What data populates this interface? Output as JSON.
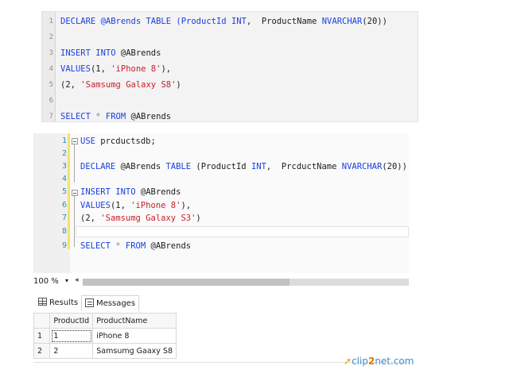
{
  "snippet": {
    "lines": [
      "1",
      "2",
      "3",
      "4",
      "5",
      "6",
      "7"
    ],
    "code": {
      "l1_a": "DECLARE @ABrends TABLE (ProductId ",
      "l1_int": "INT",
      "l1_b": ",  ProductName ",
      "l1_nv": "NVARCHAR",
      "l1_c": "(20))",
      "l3_a": "INSERT INTO",
      "l3_b": " @ABrends",
      "l4_a": "VALUES",
      "l4_b": "(1, ",
      "l4_str": "'iPhone 8'",
      "l4_c": "),",
      "l5_a": "(2, ",
      "l5_str": "'Samsumg Galaxy S8'",
      "l5_b": ")",
      "l7_a": "SELECT",
      "l7_b": " * ",
      "l7_c": "FROM",
      "l7_d": " @ABrends"
    }
  },
  "editor": {
    "lines": [
      "1",
      "2",
      "3",
      "4",
      "5",
      "6",
      "7",
      "8",
      "9"
    ],
    "code": {
      "l1_a": "USE",
      "l1_b": " prcductsdb;",
      "l3_a": "DECLARE",
      "l3_b": " @ABrends ",
      "l3_c": "TABLE",
      "l3_d": " (ProductId ",
      "l3_int": "INT",
      "l3_e": ",  PrcductName ",
      "l3_nv": "NVARCHAR",
      "l3_f": "(20))",
      "l5_a": "INSERT INTO",
      "l5_b": " @ABrends",
      "l6_a": "VALUES",
      "l6_b": "(1, ",
      "l6_str": "'iPhone 8'",
      "l6_c": "),",
      "l7_a": "(2, ",
      "l7_str": "'Samsumg Galaxy S3'",
      "l7_b": ")",
      "l9_a": "SELECT",
      "l9_b": " * ",
      "l9_c": "FROM",
      "l9_d": " @ABrends"
    }
  },
  "statusbar": {
    "zoom": "100 %",
    "dropdown_glyph": "▾",
    "scroll_left_glyph": "◂"
  },
  "result_tabs": {
    "results": "Results",
    "messages": "Messages"
  },
  "grid": {
    "columns": [
      "ProductId",
      "ProductName"
    ],
    "rows": [
      {
        "num": "1",
        "id": "1",
        "name": "iPhone 8"
      },
      {
        "num": "2",
        "id": "2",
        "name": "Samsumg Gaaxy S8"
      }
    ]
  },
  "watermark": {
    "a": "clip",
    "b": "2",
    "c": "net",
    "d": ".com"
  }
}
